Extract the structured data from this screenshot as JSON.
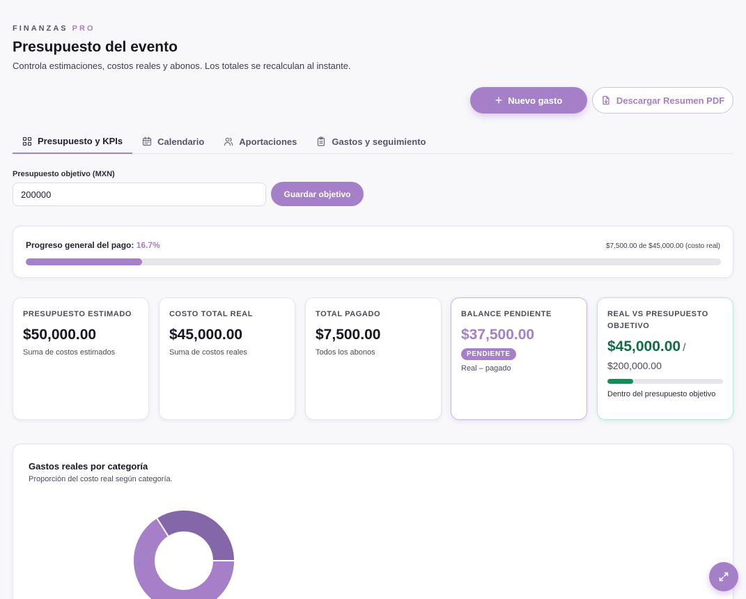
{
  "header": {
    "brand_main": "FINANZAS",
    "brand_accent": "PRO",
    "title": "Presupuesto del evento",
    "subtitle": "Controla estimaciones, costos reales y abonos. Los totales se recalculan al instante."
  },
  "actions": {
    "new_expense": "Nuevo gasto",
    "download_pdf": "Descargar Resumen PDF"
  },
  "tabs": [
    {
      "label": "Presupuesto y KPIs",
      "icon": "grid-icon",
      "active": true
    },
    {
      "label": "Calendario",
      "icon": "calendar-icon",
      "active": false
    },
    {
      "label": "Aportaciones",
      "icon": "users-icon",
      "active": false
    },
    {
      "label": "Gastos y seguimiento",
      "icon": "clipboard-icon",
      "active": false
    }
  ],
  "target": {
    "label": "Presupuesto objetivo (MXN)",
    "value": "200000",
    "save_label": "Guardar objetivo"
  },
  "progress": {
    "label": "Progreso general del pago:",
    "percent_text": "16.7%",
    "fraction": 0.167,
    "summary": "$7,500.00 de $45,000.00 (costo real)"
  },
  "kpis": {
    "estimated": {
      "title": "PRESUPUESTO ESTIMADO",
      "value": "$50,000.00",
      "note": "Suma de costos estimados"
    },
    "real_total": {
      "title": "COSTO TOTAL REAL",
      "value": "$45,000.00",
      "note": "Suma de costos reales"
    },
    "paid": {
      "title": "TOTAL PAGADO",
      "value": "$7,500.00",
      "note": "Todos los abonos"
    },
    "balance": {
      "title": "BALANCE PENDIENTE",
      "value": "$37,500.00",
      "badge": "PENDIENTE",
      "note": "Real – pagado"
    },
    "real_vs_target": {
      "title": "REAL VS PRESUPUESTO OBJETIVO",
      "value": "$45,000.00",
      "separator": "/",
      "target": "$200,000.00",
      "fraction": 0.225,
      "note": "Dentro del presupuesto objetivo"
    }
  },
  "chart": {
    "title": "Gastos reales por categoría",
    "subtitle": "Proporción del costo real según categoría."
  },
  "chart_data": {
    "type": "pie",
    "title": "Gastos reales por categoría",
    "slices": [
      {
        "value": 0.66,
        "color": "#a57fc7"
      },
      {
        "value": 0.34,
        "color": "#8467a8"
      }
    ]
  },
  "colors": {
    "accent": "#a57fc7",
    "success": "#198a5c",
    "success_text": "#136b47"
  },
  "fab_icon": "expand-icon"
}
